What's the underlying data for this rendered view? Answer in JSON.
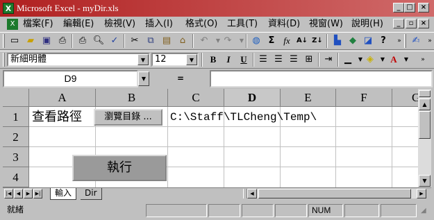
{
  "window": {
    "title": "Microsoft Excel - myDir.xls",
    "app_icon": "X",
    "controls": [
      "minimize",
      "maximize",
      "close"
    ]
  },
  "menu": {
    "items": [
      "檔案(F)",
      "編輯(E)",
      "檢視(V)",
      "插入(I)",
      "格式(O)",
      "工具(T)",
      "資料(D)",
      "視窗(W)",
      "說明(H)"
    ]
  },
  "toolbar_standard": {
    "icons": [
      "new-icon",
      "open-icon",
      "save-icon",
      "print-setup-icon",
      "print-icon",
      "print-preview-icon",
      "spelling-icon",
      "cut-icon",
      "copy-icon",
      "paste-icon",
      "format-painter-icon",
      "undo-icon",
      "redo-icon",
      "hyperlink-icon",
      "autosum-icon",
      "function-icon",
      "sort-ascending-icon",
      "sort-descending-icon",
      "chart-wizard-icon",
      "map-icon",
      "drawing-icon",
      "help-icon"
    ]
  },
  "toolbar_format": {
    "font_name": "新細明體",
    "font_size": "12",
    "bold": "B",
    "italic": "I",
    "underline": "U"
  },
  "formula_bar": {
    "name_box": "D9",
    "equals": "="
  },
  "grid": {
    "columns": [
      "A",
      "B",
      "C",
      "D",
      "E",
      "F",
      "G"
    ],
    "rows": [
      "1",
      "2",
      "3",
      "4"
    ],
    "cells": {
      "A1": "查看路徑",
      "C1": "C:\\Staff\\TLCheng\\Temp\\"
    },
    "browse_button": "瀏覽目錄 ...",
    "run_button": "執行"
  },
  "sheets": {
    "tabs": [
      "輸入",
      "Dir"
    ],
    "active": "輸入"
  },
  "status": {
    "mode": "就緒",
    "num": "NUM"
  }
}
